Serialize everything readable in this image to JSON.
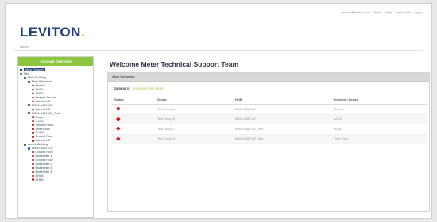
{
  "header": {
    "logo_text": "LEVITON",
    "logo_dot": ".",
    "brand_color": "#1f3f7a",
    "accent_color": "#f2a900",
    "top_links": [
      "leviton@leviton.com",
      "Home",
      "Help",
      "Contact Us",
      "Logout"
    ],
    "breadcrumb": "Home"
  },
  "sidebar": {
    "header": "Account Overview",
    "header_color": "#8cc63f",
    "tree": [
      {
        "label": "Main Support",
        "level": 0,
        "icon": "root-icon",
        "selected": true
      },
      {
        "label": "Ulot",
        "level": 0,
        "icon": "folder-icon"
      },
      {
        "label": "Main Building",
        "level": 1,
        "icon": "building-icon"
      },
      {
        "label": "Main Electrical",
        "level": 2,
        "icon": "module-icon"
      },
      {
        "label": "Meter 1",
        "level": 3,
        "icon": "device-icon"
      },
      {
        "label": "AHU1",
        "level": 3,
        "icon": "device-icon"
      },
      {
        "label": "AHU2",
        "level": 3,
        "icon": "device-icon"
      },
      {
        "label": "Multiple Device",
        "level": 3,
        "icon": "device-icon"
      },
      {
        "label": "Internal I/O",
        "level": 3,
        "icon": "device-icon"
      },
      {
        "label": "BR00-04817AF",
        "level": 2,
        "icon": "module-icon"
      },
      {
        "label": "Internal I/O",
        "level": 3,
        "icon": "device-icon"
      },
      {
        "label": "BR00-04817AF_Test",
        "level": 2,
        "icon": "module-icon"
      },
      {
        "label": "Plugs",
        "level": 3,
        "icon": "device-icon"
      },
      {
        "label": "HVAC",
        "level": 3,
        "icon": "device-icon"
      },
      {
        "label": "Second Floor",
        "level": 3,
        "icon": "device-icon"
      },
      {
        "label": "Third Floor",
        "level": 3,
        "icon": "device-icon"
      },
      {
        "label": "AHU3",
        "level": 3,
        "icon": "device-icon"
      },
      {
        "label": "Ground Floor",
        "level": 3,
        "icon": "device-icon"
      },
      {
        "label": "Internal I/O",
        "level": 3,
        "icon": "device-icon"
      },
      {
        "label": "Annex Building",
        "level": 1,
        "icon": "building-icon"
      },
      {
        "label": "BR00-04817CF",
        "level": 2,
        "icon": "module-icon"
      },
      {
        "label": "Ground Floor",
        "level": 3,
        "icon": "device-icon"
      },
      {
        "label": "Multimeter 1",
        "level": 3,
        "icon": "device-icon"
      },
      {
        "label": "Ground Floor",
        "level": 3,
        "icon": "device-icon"
      },
      {
        "label": "Multimeter 2",
        "level": 3,
        "icon": "device-icon"
      },
      {
        "label": "Multimeter 3",
        "level": 3,
        "icon": "device-icon"
      },
      {
        "label": "Multimeter 4",
        "level": 3,
        "icon": "device-icon"
      },
      {
        "label": "AHU4",
        "level": 3,
        "icon": "device-icon"
      },
      {
        "label": "AHU5",
        "level": 3,
        "icon": "device-icon"
      }
    ]
  },
  "main": {
    "title": "Welcome Meter Technical Support Team",
    "panel_title": "Alert Summary",
    "summary_label": "Summary:",
    "summary_value": "4 devices with alerts",
    "columns": [
      "Status",
      "Group",
      "HUB",
      "Protocol / Device"
    ],
    "status_color": "#c81e1e",
    "rows": [
      {
        "status": "alert",
        "group": "Test Group A",
        "hub": "BR00-04817AF",
        "device": "Meter 1"
      },
      {
        "status": "alert",
        "group": "Test Group B",
        "hub": "BR00-04817AF",
        "device": "AHU2"
      },
      {
        "status": "alert",
        "group": "Test Group C",
        "hub": "BR00-04817AF_Test",
        "device": "Plugs"
      },
      {
        "status": "alert",
        "group": "Test Group D",
        "hub": "BR00-04817AF_Test",
        "device": "Third Floor"
      }
    ]
  }
}
